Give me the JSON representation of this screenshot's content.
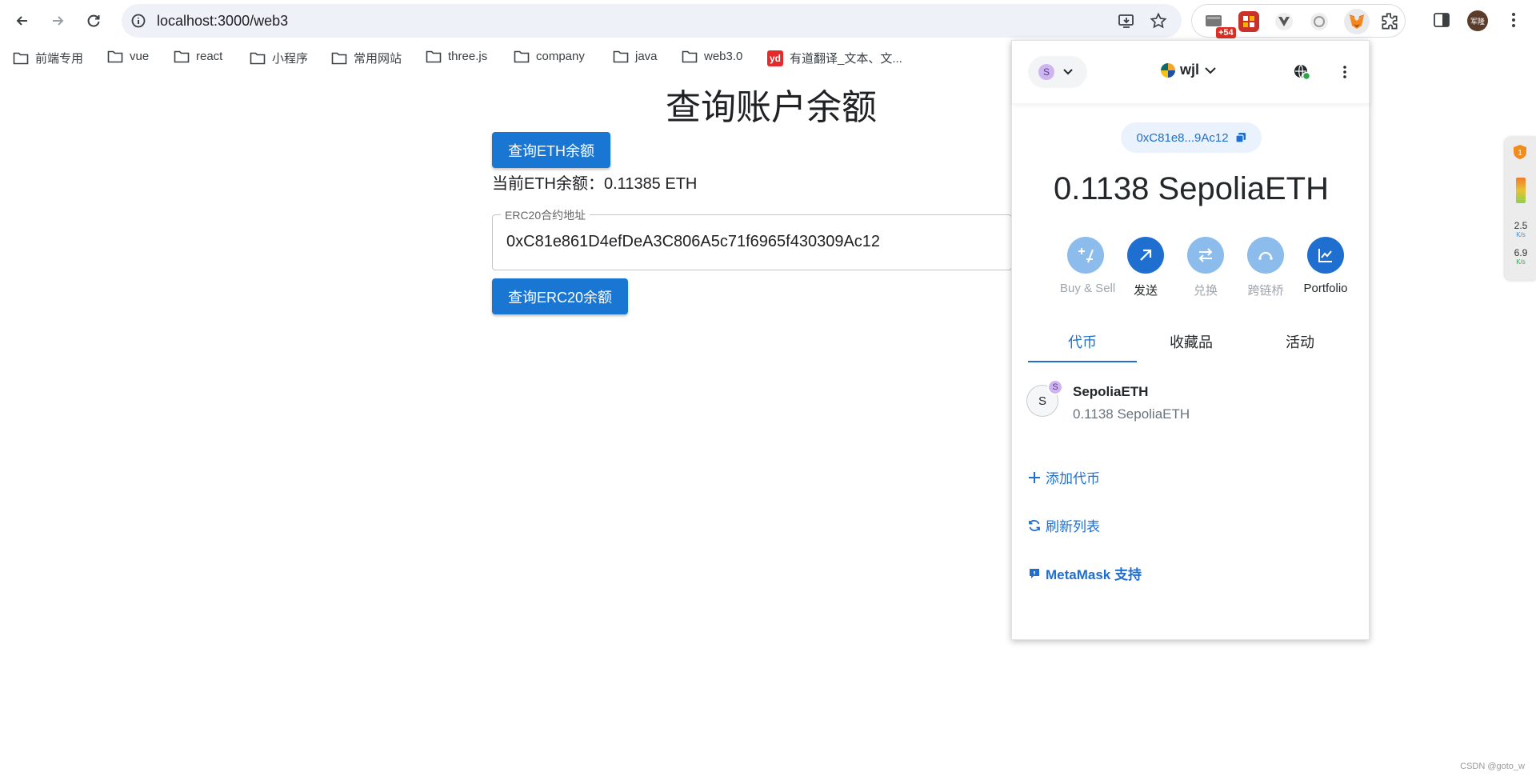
{
  "browser": {
    "url": "localhost:3000/web3",
    "profile_avatar_text": "军隆",
    "extension_badge": "+54"
  },
  "bookmarks": [
    {
      "label": "前端专用",
      "type": "folder"
    },
    {
      "label": "vue",
      "type": "folder"
    },
    {
      "label": "react",
      "type": "folder"
    },
    {
      "label": "小程序",
      "type": "folder"
    },
    {
      "label": "常用网站",
      "type": "folder"
    },
    {
      "label": "three.js",
      "type": "folder"
    },
    {
      "label": "company",
      "type": "folder"
    },
    {
      "label": "java",
      "type": "folder"
    },
    {
      "label": "web3.0",
      "type": "folder"
    },
    {
      "label": "有道翻译_文本、文...",
      "type": "link",
      "icon_text": "yd"
    }
  ],
  "page": {
    "title": "查询账户余额",
    "eth_button": "查询ETH余额",
    "eth_balance": "当前ETH余额：0.11385 ETH",
    "erc20_field_label": "ERC20合约地址",
    "erc20_field_value": "0xC81e861D4efDeA3C806A5c71f6965f430309Ac12",
    "erc20_button": "查询ERC20余额"
  },
  "metamask": {
    "network_initial": "S",
    "account_name": "wjl",
    "address_short": "0xC81e8...9Ac12",
    "balance": "0.1138 SepoliaETH",
    "actions": [
      {
        "label": "Buy & Sell",
        "icon": "plus-minus-icon",
        "enabled": false
      },
      {
        "label": "发送",
        "icon": "arrow-up-right-icon",
        "enabled": true
      },
      {
        "label": "兑换",
        "icon": "swap-icon",
        "enabled": false
      },
      {
        "label": "跨链桥",
        "icon": "bridge-icon",
        "enabled": false
      },
      {
        "label": "Portfolio",
        "icon": "chart-icon",
        "enabled": true
      }
    ],
    "tabs": [
      {
        "label": "代币",
        "active": true
      },
      {
        "label": "收藏品",
        "active": false
      },
      {
        "label": "活动",
        "active": false
      }
    ],
    "token": {
      "icon_letter": "S",
      "badge_letter": "S",
      "name": "SepoliaETH",
      "amount": "0.1138 SepoliaETH"
    },
    "add_token": "添加代币",
    "refresh_list": "刷新列表",
    "support": "MetaMask 支持",
    "colors": {
      "accent": "#1f6fd0",
      "accent_disabled": "#8cbcec"
    }
  },
  "side_widget": {
    "upload_rate": "2.5",
    "upload_unit": "K/s",
    "download_rate": "6.9",
    "download_unit": "K/s",
    "shield_number": "1"
  },
  "watermark": "CSDN @goto_w",
  "colors": {
    "primary_button": "#1976d2"
  }
}
